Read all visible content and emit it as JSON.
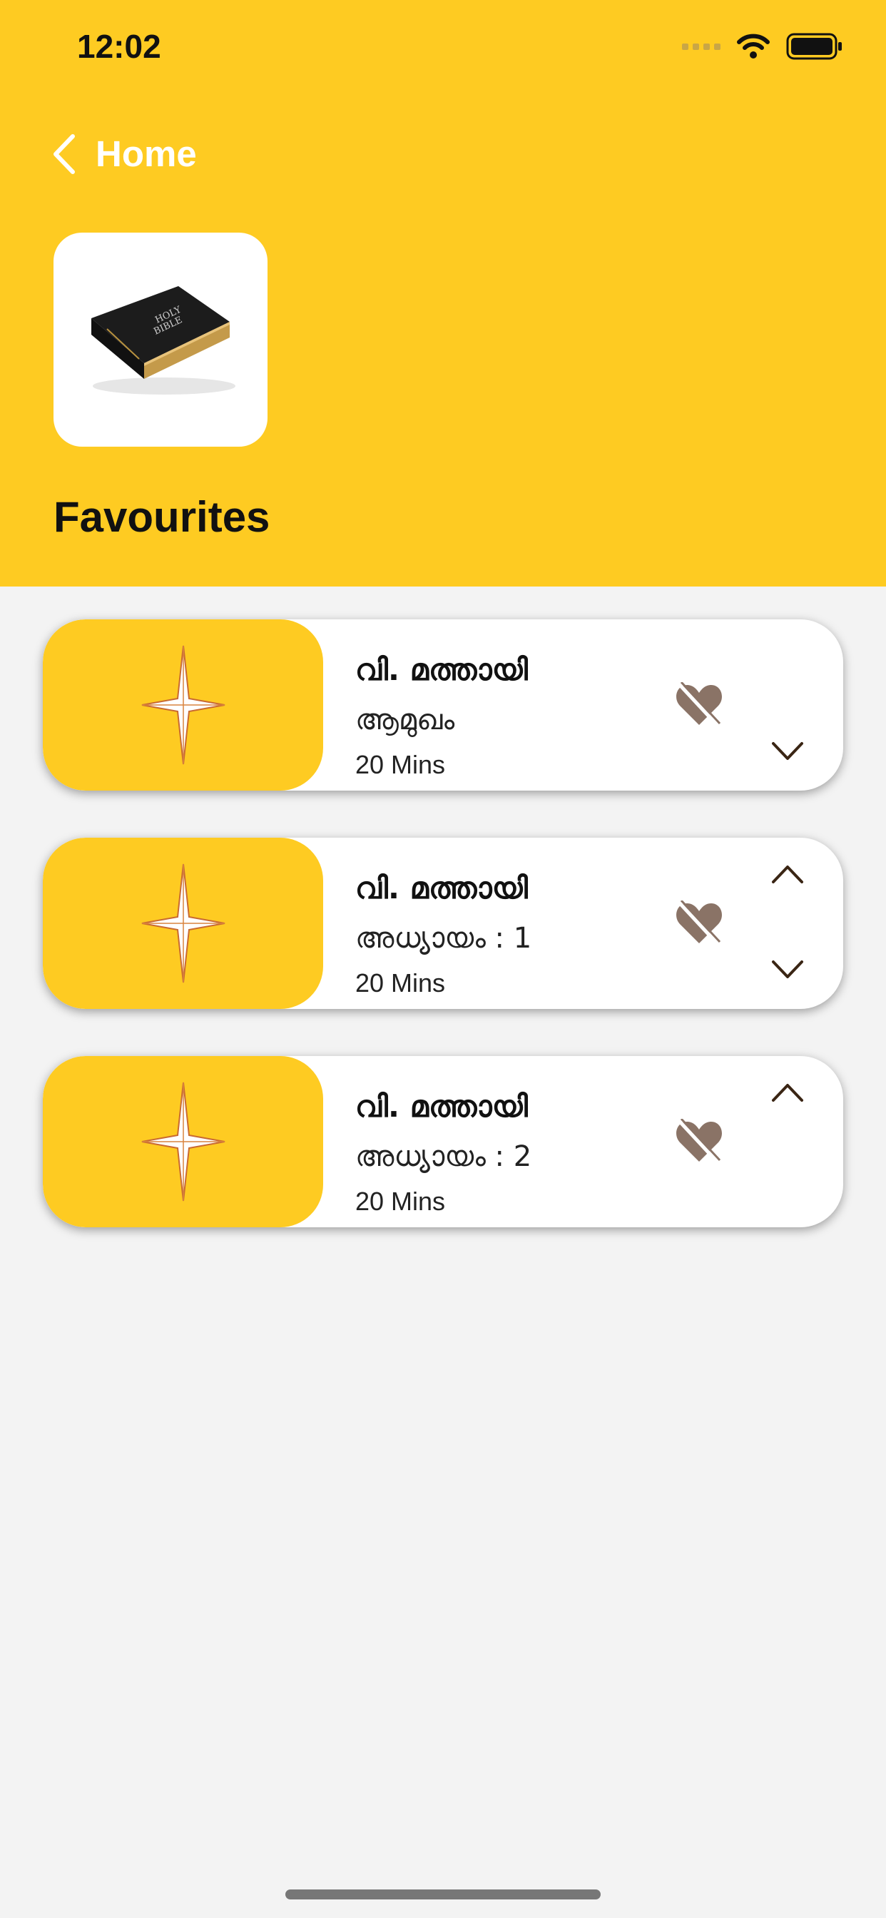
{
  "status_bar": {
    "time": "12:02"
  },
  "nav": {
    "back_label": "Home"
  },
  "header": {
    "title": "Favourites",
    "app_icon": "bible-book-image"
  },
  "items": [
    {
      "title": "വി. മത്തായി",
      "subtitle": "ആമുഖം",
      "duration": "20 Mins",
      "show_up": false,
      "show_down": true
    },
    {
      "title": "വി. മത്തായി",
      "subtitle": "അധ്യായം : 1",
      "duration": "20 Mins",
      "show_up": true,
      "show_down": true
    },
    {
      "title": "വി. മത്തായി",
      "subtitle": "അധ്യായം : 2",
      "duration": "20 Mins",
      "show_up": true,
      "show_down": false
    }
  ],
  "colors": {
    "accent": "#fecb22",
    "background": "#f3f3f3",
    "icon_brown": "#8a7366"
  }
}
